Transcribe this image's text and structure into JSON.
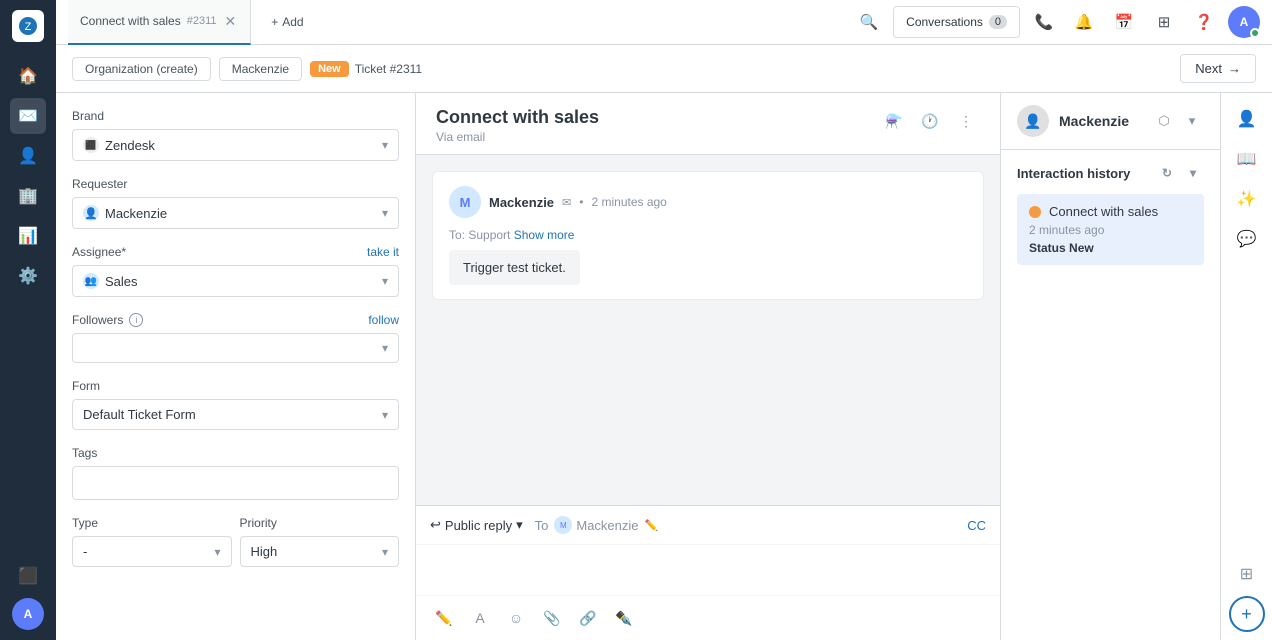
{
  "app": {
    "title": "Zendesk"
  },
  "left_nav": {
    "icons": [
      "home",
      "tickets",
      "contacts",
      "organizations",
      "reports",
      "settings",
      "apps"
    ]
  },
  "top_bar": {
    "tab_label": "Connect with sales",
    "tab_id": "#2311",
    "add_label": "Add",
    "conversations_label": "Conversations",
    "conversations_count": "0"
  },
  "breadcrumb": {
    "org_label": "Organization (create)",
    "user_label": "Mackenzie",
    "status_badge": "New",
    "ticket_label": "Ticket #2311",
    "next_label": "Next"
  },
  "left_panel": {
    "brand_label": "Brand",
    "brand_value": "Zendesk",
    "requester_label": "Requester",
    "requester_value": "Mackenzie",
    "assignee_label": "Assignee*",
    "assignee_take": "take it",
    "assignee_value": "Sales",
    "followers_label": "Followers",
    "followers_follow": "follow",
    "form_label": "Form",
    "form_value": "Default Ticket Form",
    "tags_label": "Tags",
    "type_label": "Type",
    "type_value": "-",
    "priority_label": "Priority",
    "priority_value": "High"
  },
  "ticket": {
    "title": "Connect with sales",
    "subtitle": "Via email",
    "sender": "Mackenzie",
    "sender_time": "2 minutes ago",
    "to_label": "To:",
    "to_value": "Support",
    "show_more": "Show more",
    "message_body": "Trigger test ticket."
  },
  "reply": {
    "type_label": "Public reply",
    "to_label": "To",
    "to_name": "Mackenzie",
    "cc_label": "CC"
  },
  "right_panel": {
    "name": "Mackenzie",
    "interaction_history_label": "Interaction history",
    "item_title": "Connect with sales",
    "item_time": "2 minutes ago",
    "item_status_label": "Status",
    "item_status_value": "New"
  }
}
